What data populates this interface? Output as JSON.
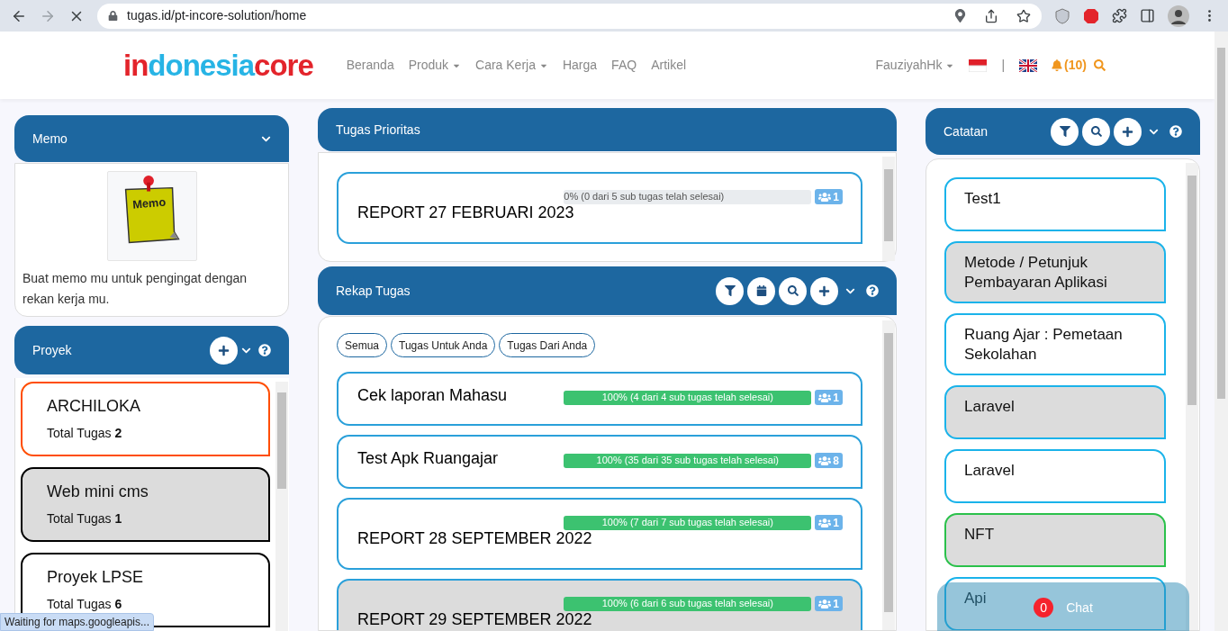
{
  "browser": {
    "url": "tugas.id/pt-incore-solution/home",
    "status": "Waiting for maps.googleapis..."
  },
  "navbar": {
    "logo": [
      {
        "text": "in",
        "color": "#e3242b"
      },
      {
        "text": "donesia",
        "color": "#27b4e5"
      },
      {
        "text": "core",
        "color": "#e3242b"
      }
    ],
    "links": [
      {
        "label": "Beranda",
        "dropdown": false
      },
      {
        "label": "Produk",
        "dropdown": true
      },
      {
        "label": "Cara Kerja",
        "dropdown": true
      },
      {
        "label": "Harga",
        "dropdown": false
      },
      {
        "label": "FAQ",
        "dropdown": false
      },
      {
        "label": "Artikel",
        "dropdown": false
      }
    ],
    "user": "FauziyahHk",
    "separator": "|",
    "notifications": "(10)"
  },
  "memo": {
    "title": "Memo",
    "image_label": "Memo",
    "text": "Buat memo mu untuk pengingat dengan rekan kerja mu."
  },
  "projects": {
    "title": "Proyek",
    "items": [
      {
        "name": "ARCHILOKA",
        "count_label": "Total Tugas",
        "count": "2",
        "color": "#ff4d00",
        "shaded": false
      },
      {
        "name": "Web mini cms",
        "count_label": "Total Tugas",
        "count": "1",
        "color": "#000000",
        "shaded": true
      },
      {
        "name": "Proyek LPSE",
        "count_label": "Total Tugas",
        "count": "6",
        "color": "#000000",
        "shaded": false
      }
    ]
  },
  "priority": {
    "title": "Tugas Prioritas",
    "tasks": [
      {
        "title": "REPORT 27 FEBRUARI 2023",
        "kind": "stacked",
        "shaded": false,
        "progress": "0% (0 dari 5 sub tugas telah selesai)",
        "level": 0,
        "members": "1"
      }
    ]
  },
  "recap": {
    "title": "Rekap Tugas",
    "filters": [
      "Semua",
      "Tugas Untuk Anda",
      "Tugas Dari Anda"
    ],
    "tasks": [
      {
        "title": "Cek laporan Mahasu",
        "kind": "inline",
        "shaded": false,
        "progress": "100% (4 dari 4 sub tugas telah selesai)",
        "level": 1,
        "members": "1"
      },
      {
        "title": "Test Apk Ruangajar",
        "kind": "inline",
        "shaded": false,
        "progress": "100% (35 dari 35 sub tugas telah selesai)",
        "level": 1,
        "members": "8"
      },
      {
        "title": "REPORT 28 SEPTEMBER 2022",
        "kind": "stacked",
        "shaded": false,
        "progress": "100% (7 dari 7 sub tugas telah selesai)",
        "level": 1,
        "members": "1"
      },
      {
        "title": "REPORT 29 SEPTEMBER 2022",
        "kind": "stacked",
        "shaded": true,
        "progress": "100% (6 dari 6 sub tugas telah selesai)",
        "level": 1,
        "members": "1"
      }
    ]
  },
  "notes": {
    "title": "Catatan",
    "items": [
      {
        "title": "Test1",
        "color": "#1ab3ea",
        "shaded": false
      },
      {
        "title": "Metode / Petunjuk Pembayaran Aplikasi",
        "color": "#1ab3ea",
        "shaded": true
      },
      {
        "title": "Ruang Ajar : Pemetaan Sekolahan",
        "color": "#1ab3ea",
        "shaded": false
      },
      {
        "title": "Laravel",
        "color": "#1ab3ea",
        "shaded": true
      },
      {
        "title": "Laravel",
        "color": "#1ab3ea",
        "shaded": false
      },
      {
        "title": "NFT",
        "color": "#2bc14b",
        "shaded": true
      },
      {
        "title": "Api",
        "color": "#1ab3ea",
        "shaded": false
      }
    ]
  },
  "chat": {
    "label": "Chat",
    "unread": "0"
  }
}
